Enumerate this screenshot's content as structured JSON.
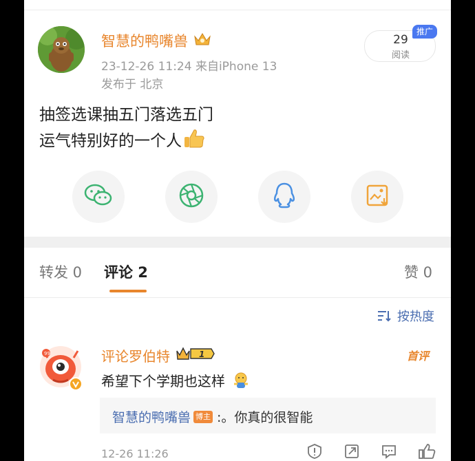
{
  "post": {
    "author": "智慧的鸭嘴兽",
    "meta_line": "23-12-26 11:24 来自iPhone 13",
    "location_line": "发布于 北京",
    "text_lines": [
      "抽签选课抽五门落选五门",
      "运气特别好的一个人"
    ],
    "reads": {
      "count": "29",
      "label": "阅读",
      "badge": "推广"
    }
  },
  "share_icons": [
    "wechat-icon",
    "moments-icon",
    "qq-icon",
    "save-image-icon"
  ],
  "tabs": {
    "repost": "转发 0",
    "comments": "评论 2",
    "likes": "赞 0"
  },
  "sort": {
    "label": "按热度"
  },
  "comment": {
    "author": "评论罗伯特",
    "level": "1",
    "tag": "首评",
    "text": "希望下个学期也这样",
    "reply": {
      "author": "智慧的鸭嘴兽",
      "badge": "博主",
      "text": ":。你真的很智能"
    },
    "time": "12-26 11:26"
  },
  "colors": {
    "accent_orange": "#e8862d",
    "link_blue": "#4a6db0",
    "promo_blue": "#4a78f0"
  }
}
